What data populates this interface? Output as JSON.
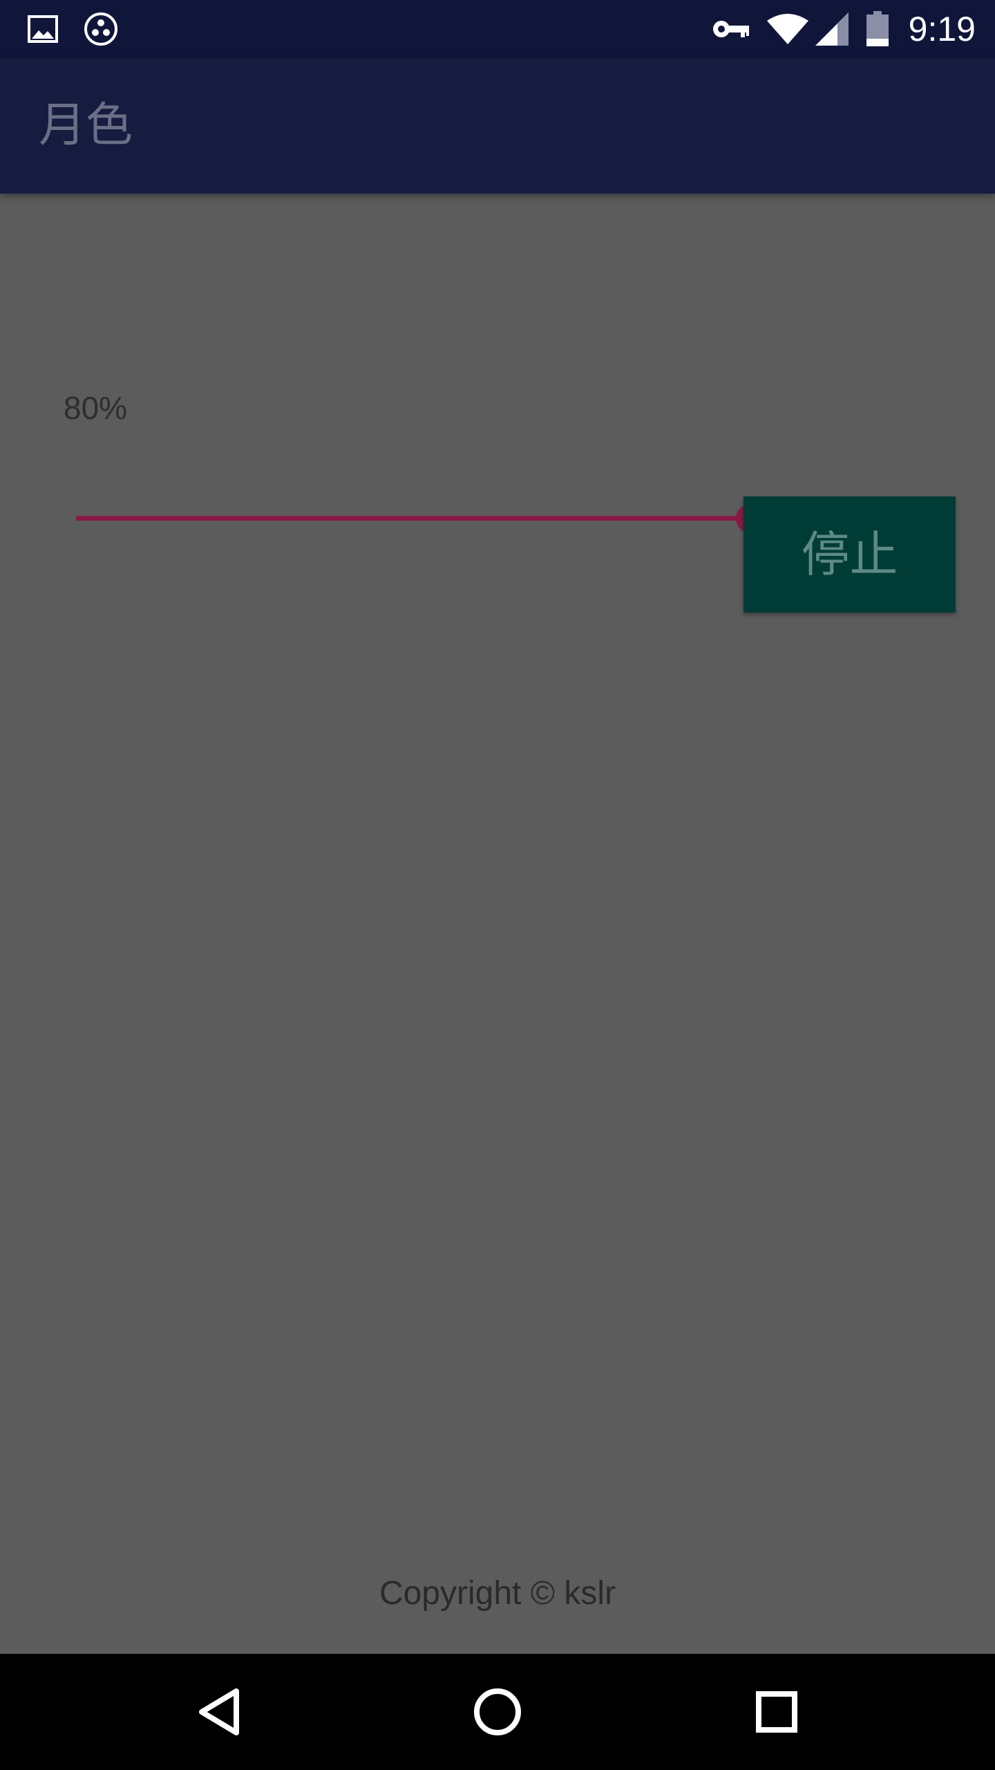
{
  "status_bar": {
    "time": "9:19",
    "left_icons": [
      "image-icon",
      "apps-dots-icon"
    ],
    "right_icons": [
      "vpn-key-icon",
      "wifi-icon",
      "cellular-signal-icon",
      "battery-icon"
    ],
    "background": "#10163a"
  },
  "app_bar": {
    "title": "月色",
    "background": "#161b40"
  },
  "slider": {
    "value_percent": 80,
    "accent_color": "#8a1a45"
  },
  "percent_label": "80%",
  "stop_button": {
    "label": "停止",
    "background": "#003c36"
  },
  "footer": {
    "copyright": "Copyright © kslr"
  },
  "nav_bar": {
    "buttons": [
      "back-icon",
      "home-icon",
      "recents-icon"
    ]
  }
}
